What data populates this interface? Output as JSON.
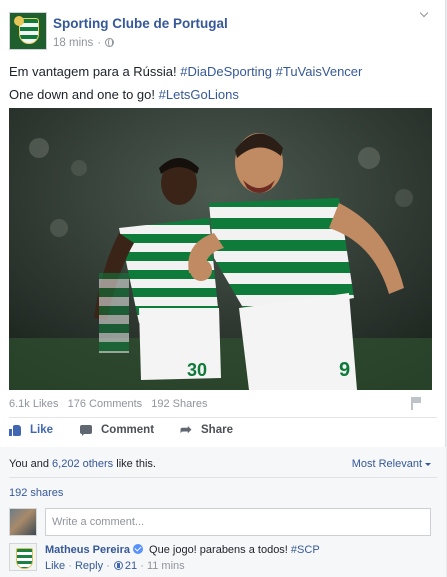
{
  "post": {
    "page_name": "Sporting Clube de Portugal",
    "timestamp": "18 mins",
    "separator": "·",
    "text_line1_plain": "Em vantagem para a Rússia! ",
    "text_line1_tags": "#DiaDeSporting #TuVaisVencer",
    "text_line2_plain": "One down and one to go! ",
    "text_line2_tags": "#LetsGoLions",
    "icons": [
      "globe-icon",
      "chevron-down-icon",
      "flag-icon"
    ]
  },
  "photo": {
    "jersey_number_left": "30",
    "jersey_number_right": "9",
    "colors": {
      "green": "#0f7b3a",
      "white": "#f2f2f2",
      "skin_dark": "#3a2418",
      "skin_light": "#c08a63"
    }
  },
  "stats": {
    "likes": "6.1k Likes",
    "comments": "176 Comments",
    "shares": "192 Shares"
  },
  "actions": {
    "like": "Like",
    "comment": "Comment",
    "share": "Share"
  },
  "engagement": {
    "you_and": "You and ",
    "others_link": "6,202 others",
    "like_this": " like this.",
    "most_relevant": "Most Relevant",
    "shares_link": "192 shares"
  },
  "comment_input": {
    "placeholder": "Write a comment..."
  },
  "top_comment": {
    "author": "Matheus Pereira",
    "text_plain": " Que jogo! parabens a todos! ",
    "text_tag": "#SCP",
    "like_label": "Like",
    "reply_label": "Reply",
    "like_count": "21",
    "time": "11 mins",
    "separator": "·"
  },
  "colors": {
    "link_blue": "#365899",
    "fb_blue": "#4267b2",
    "muted": "#90949c"
  }
}
